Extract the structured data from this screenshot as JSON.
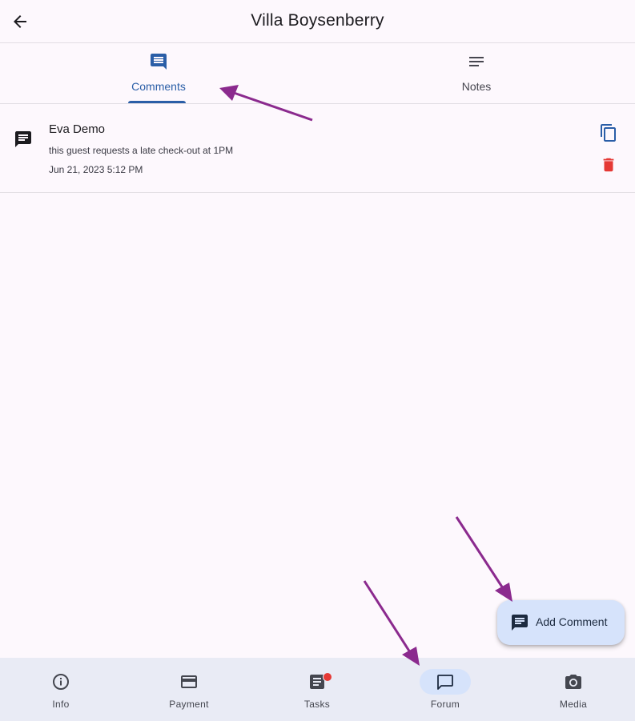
{
  "header": {
    "title": "Villa Boysenberry",
    "back_icon": "arrow-left-icon"
  },
  "tabs": [
    {
      "label": "Comments",
      "icon": "comment-icon",
      "selected": true
    },
    {
      "label": "Notes",
      "icon": "notes-icon",
      "selected": false
    }
  ],
  "comments": [
    {
      "author": "Eva Demo",
      "text": "this guest requests a late check-out at 1PM",
      "date": "Jun 21, 2023 5:12 PM"
    }
  ],
  "fab": {
    "label": "Add Comment",
    "icon": "comment-icon"
  },
  "bottom_nav": [
    {
      "label": "Info",
      "icon": "info-icon"
    },
    {
      "label": "Payment",
      "icon": "credit-card-icon"
    },
    {
      "label": "Tasks",
      "icon": "tasks-icon",
      "badge": true
    },
    {
      "label": "Forum",
      "icon": "forum-icon",
      "selected": true
    },
    {
      "label": "Media",
      "icon": "camera-icon"
    }
  ],
  "colors": {
    "accent": "#2a5ea7",
    "delete": "#e53935",
    "annotation_arrow": "#8b2a8e",
    "nav_background": "#e9ebf5",
    "selected_pill": "#d6e3fb"
  }
}
